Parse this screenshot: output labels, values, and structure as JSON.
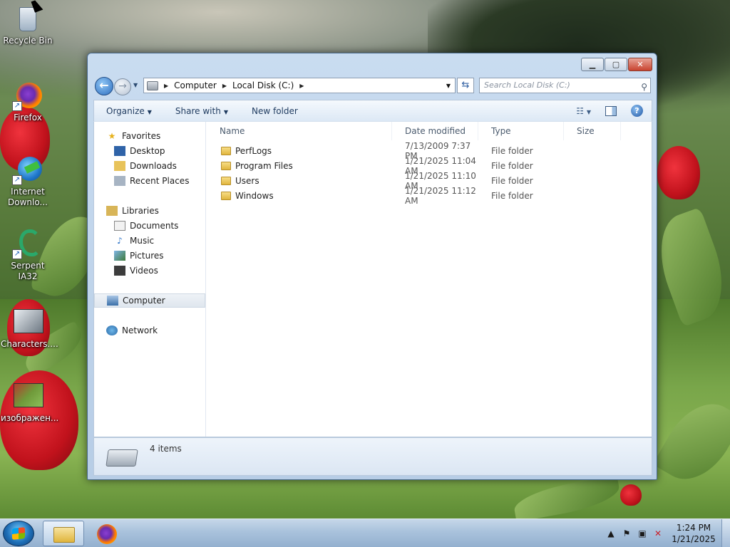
{
  "desktop": {
    "icons": [
      {
        "label": "Recycle Bin"
      },
      {
        "label": "Firefox"
      },
      {
        "label": "Internet Downlo..."
      },
      {
        "label": "Serpent IA32"
      },
      {
        "label": "Characters...."
      },
      {
        "label": "изображен..."
      }
    ]
  },
  "window": {
    "address": {
      "crumbs": [
        "Computer",
        "Local Disk (C:)"
      ],
      "search_placeholder": "Search Local Disk (C:)"
    },
    "toolbar": {
      "organize": "Organize",
      "share_with": "Share with",
      "new_folder": "New folder"
    },
    "navpane": {
      "favorites": "Favorites",
      "desktop": "Desktop",
      "downloads": "Downloads",
      "recent": "Recent Places",
      "libraries": "Libraries",
      "documents": "Documents",
      "music": "Music",
      "pictures": "Pictures",
      "videos": "Videos",
      "computer": "Computer",
      "network": "Network"
    },
    "columns": {
      "name": "Name",
      "date": "Date modified",
      "type": "Type",
      "size": "Size"
    },
    "files": [
      {
        "name": "PerfLogs",
        "date": "7/13/2009 7:37 PM",
        "type": "File folder"
      },
      {
        "name": "Program Files",
        "date": "1/21/2025 11:04 AM",
        "type": "File folder"
      },
      {
        "name": "Users",
        "date": "1/21/2025 11:10 AM",
        "type": "File folder"
      },
      {
        "name": "Windows",
        "date": "1/21/2025 11:12 AM",
        "type": "File folder"
      }
    ],
    "details": {
      "count": "4 items"
    }
  },
  "taskbar": {
    "time": "1:24 PM",
    "date": "1/21/2025"
  }
}
